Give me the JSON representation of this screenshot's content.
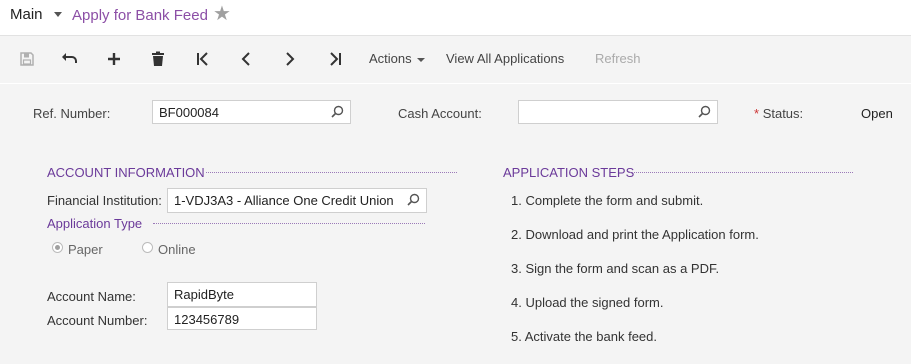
{
  "breadcrumb": {
    "main": "Main",
    "title": "Apply for Bank Feed"
  },
  "toolbar": {
    "icons": [
      "save-icon",
      "undo-icon",
      "add-icon",
      "delete-icon",
      "first-icon",
      "previous-icon",
      "next-icon",
      "last-icon"
    ],
    "actions_label": "Actions",
    "view_all_label": "View All Applications",
    "refresh_label": "Refresh"
  },
  "header": {
    "ref_number_label": "Ref. Number:",
    "ref_number_value": "BF000084",
    "cash_account_label": "Cash Account:",
    "cash_account_value": "",
    "status_required_mark": "*",
    "status_label": "Status:",
    "status_value": "Open"
  },
  "account_info": {
    "heading": "ACCOUNT INFORMATION",
    "financial_institution_label": "Financial Institution:",
    "financial_institution_value": "1-VDJ3A3 - Alliance One Credit Union",
    "application_type_heading": "Application Type",
    "application_type_options": [
      "Paper",
      "Online"
    ],
    "application_type_selected": "Paper",
    "account_name_label": "Account Name:",
    "account_name_value": "RapidByte",
    "account_number_label": "Account Number:",
    "account_number_value": "123456789"
  },
  "application_steps": {
    "heading": "APPLICATION STEPS",
    "steps": [
      "1. Complete the form and submit.",
      "2. Download and print the Application form.",
      "3. Sign the form and scan as a PDF.",
      "4. Upload the signed form.",
      "5. Activate the bank feed."
    ]
  },
  "colors": {
    "accent": "#8c4fa6",
    "section_heading": "#6b3a9a",
    "required": "#cc3333",
    "panel_bg": "#f4f4f4"
  }
}
